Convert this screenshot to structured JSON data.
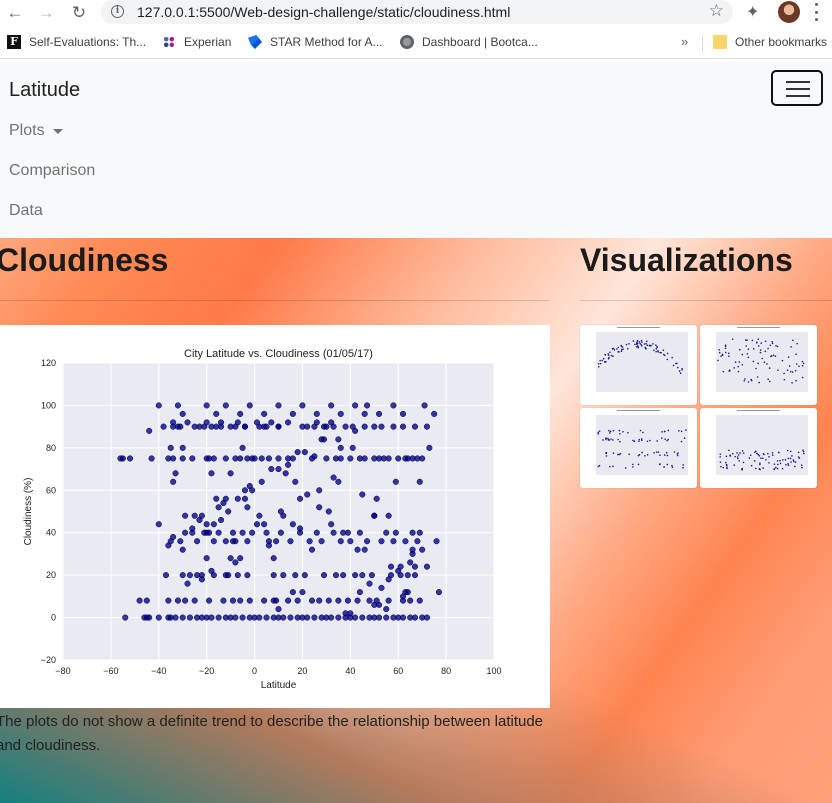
{
  "browser": {
    "url": "127.0.0.1:5500/Web-design-challenge/static/cloudiness.html",
    "bookmarks": [
      {
        "label": "Self-Evaluations: Th...",
        "icon": "faculty-f-icon"
      },
      {
        "label": "Experian",
        "icon": "experian-icon"
      },
      {
        "label": "STAR Method for A...",
        "icon": "star-method-icon"
      },
      {
        "label": "Dashboard | Bootca...",
        "icon": "globe-icon"
      }
    ],
    "more_label": "»",
    "other_bookmarks": "Other bookmarks"
  },
  "navbar": {
    "brand": "Latitude",
    "links": [
      "Plots",
      "Comparison",
      "Data"
    ]
  },
  "main": {
    "title": "Cloudiness",
    "description": "The plots do not show a definite trend to describe the relationship between latitude and cloudiness."
  },
  "sidebar": {
    "title": "Visualizations",
    "thumbnails": [
      "Latitude vs Max Temperature",
      "Latitude vs Humidity",
      "Latitude vs Cloudiness",
      "Latitude vs Wind Speed"
    ]
  },
  "chart_data": {
    "type": "scatter",
    "title": "City Latitude vs. Cloudiness (01/05/17)",
    "xlabel": "Latitude",
    "ylabel": "Cloudiness (%)",
    "xlim": [
      -80,
      100
    ],
    "ylim": [
      -20,
      120
    ],
    "xticks": [
      -80,
      -60,
      -40,
      -20,
      0,
      20,
      40,
      60,
      80,
      100
    ],
    "yticks": [
      -20,
      0,
      20,
      40,
      60,
      80,
      100,
      120
    ],
    "grid": true,
    "marker_color": "#00008b",
    "x": [
      -54,
      -46,
      -45,
      -44,
      -40,
      -36,
      -35,
      -33,
      -30,
      -27,
      -24,
      -22,
      -20,
      -18,
      -15,
      -12,
      -10,
      -8,
      -5,
      -2,
      0,
      2,
      5,
      8,
      10,
      12,
      15,
      18,
      20,
      22,
      25,
      28,
      30,
      32,
      35,
      38,
      40,
      42,
      45,
      48,
      50,
      52,
      55,
      58,
      60,
      62,
      65,
      67,
      70,
      72,
      -55,
      -52,
      -43,
      -36,
      -34,
      -30,
      -26,
      -20,
      -19,
      -17,
      -12,
      -8,
      -6,
      -3,
      0,
      3,
      6,
      10,
      14,
      16,
      24,
      30,
      34,
      36,
      40,
      44,
      46,
      50,
      52,
      54,
      56,
      60,
      64,
      66,
      68,
      70,
      -38,
      -34,
      -32,
      -28,
      -23,
      -20,
      -16,
      -14,
      -10,
      -7,
      -4,
      1,
      4,
      7,
      10,
      14,
      20,
      26,
      29,
      32,
      -34,
      -31,
      -25,
      -21,
      -18,
      -14,
      -8,
      -4,
      2,
      5,
      10,
      22,
      25,
      30,
      33,
      38,
      41,
      46,
      50,
      53,
      58,
      62,
      67,
      72,
      -48,
      -45,
      -36,
      -32,
      -29,
      -25,
      -19,
      -13,
      -9,
      -6,
      -2,
      4,
      9,
      14,
      18,
      24,
      27,
      31,
      35,
      39,
      43,
      48,
      51,
      56,
      62,
      65,
      69,
      -37,
      -30,
      -27,
      -22,
      -17,
      -11,
      -7,
      -3,
      8,
      12,
      17,
      21,
      29,
      34,
      37,
      42,
      45,
      49,
      57,
      61,
      64,
      67,
      -29,
      -26,
      -20,
      -15,
      -9,
      -5,
      -1,
      11,
      19,
      26,
      33,
      39,
      44,
      55,
      59,
      66,
      69,
      -35,
      -31,
      -24,
      -17,
      -12,
      -8,
      -3,
      6,
      15,
      23,
      28,
      36,
      47,
      53,
      58,
      63,
      68,
      -56,
      -44,
      -35,
      -33,
      -30,
      -25,
      -21,
      -16,
      -10,
      -5,
      -1,
      4,
      12,
      19,
      27,
      36,
      43,
      51,
      57,
      63,
      69,
      73,
      -34,
      -29,
      -20,
      -12,
      -6,
      2,
      9,
      16,
      24,
      32,
      41,
      50,
      59,
      67,
      77,
      -40,
      -24,
      -18,
      -9,
      -4,
      8,
      17,
      27,
      37,
      46,
      55,
      64,
      72,
      -30,
      -22,
      -15,
      -7,
      3,
      14,
      28,
      40,
      52,
      62,
      -28,
      -18,
      -10,
      1,
      11,
      22,
      33,
      44,
      56,
      65,
      -36,
      -26,
      -14,
      -4,
      7,
      18,
      29,
      42,
      53,
      60,
      66,
      -34,
      -23,
      -13,
      -2,
      10,
      21,
      35,
      48,
      61,
      70,
      -19,
      -11,
      -1,
      13,
      25,
      38,
      50,
      63,
      -22,
      -8,
      6,
      19,
      31,
      47,
      58,
      71,
      -40,
      -32,
      -20,
      -12,
      -2,
      10,
      20,
      32,
      42,
      52,
      62,
      75,
      -30,
      -16,
      -6,
      4,
      16,
      26,
      36,
      46,
      56,
      66,
      76,
      -20,
      -17,
      -12,
      -3,
      5,
      8,
      10,
      16,
      20,
      35,
      40,
      45,
      50,
      55,
      65,
      78
    ],
    "y": [
      0,
      0,
      0,
      0,
      0,
      0,
      0,
      0,
      0,
      0,
      0,
      0,
      0,
      0,
      0,
      0,
      0,
      0,
      0,
      0,
      0,
      0,
      0,
      0,
      0,
      0,
      0,
      0,
      0,
      0,
      0,
      0,
      0,
      0,
      0,
      0,
      0,
      0,
      0,
      0,
      0,
      0,
      0,
      0,
      0,
      0,
      0,
      0,
      0,
      0,
      75,
      75,
      75,
      75,
      75,
      75,
      75,
      75,
      75,
      75,
      75,
      75,
      75,
      75,
      75,
      75,
      75,
      75,
      75,
      75,
      75,
      75,
      75,
      75,
      75,
      75,
      75,
      75,
      75,
      75,
      75,
      75,
      75,
      75,
      75,
      75,
      90,
      92,
      90,
      92,
      90,
      92,
      90,
      92,
      90,
      92,
      90,
      92,
      90,
      92,
      90,
      92,
      90,
      92,
      90,
      92,
      90,
      90,
      90,
      90,
      90,
      90,
      90,
      90,
      90,
      90,
      90,
      90,
      90,
      90,
      90,
      90,
      90,
      90,
      90,
      90,
      90,
      90,
      90,
      90,
      8,
      8,
      8,
      8,
      8,
      8,
      8,
      8,
      8,
      8,
      8,
      8,
      8,
      8,
      8,
      8,
      8,
      8,
      8,
      8,
      8,
      8,
      8,
      8,
      8,
      8,
      8,
      20,
      20,
      20,
      20,
      20,
      20,
      20,
      20,
      20,
      20,
      20,
      20,
      20,
      20,
      20,
      20,
      20,
      20,
      20,
      20,
      20,
      20,
      40,
      40,
      40,
      40,
      40,
      40,
      40,
      40,
      40,
      40,
      40,
      40,
      40,
      40,
      40,
      40,
      40,
      36,
      36,
      36,
      36,
      36,
      36,
      36,
      36,
      36,
      36,
      36,
      36,
      36,
      36,
      36,
      36,
      36,
      75,
      88,
      80,
      68,
      80,
      48,
      40,
      56,
      68,
      80,
      75,
      44,
      48,
      56,
      60,
      80,
      32,
      56,
      24,
      75,
      64,
      80,
      64,
      48,
      44,
      56,
      28,
      48,
      36,
      12,
      32,
      44,
      80,
      48,
      64,
      24,
      12,
      44,
      20,
      68,
      36,
      56,
      28,
      64,
      52,
      40,
      32,
      4,
      12,
      24,
      32,
      48,
      52,
      56,
      64,
      72,
      84,
      2,
      6,
      10,
      16,
      22,
      28,
      44,
      50,
      58,
      66,
      12,
      18,
      26,
      34,
      42,
      46,
      60,
      70,
      78,
      84,
      88,
      14,
      22,
      30,
      38,
      46,
      54,
      62,
      70,
      78,
      84,
      16,
      24,
      32,
      40,
      50,
      60,
      68,
      76,
      2,
      6,
      12,
      18,
      26,
      34,
      42,
      50,
      100,
      100,
      100,
      100,
      100,
      100,
      100,
      100,
      100,
      100,
      100,
      100,
      96,
      96,
      96,
      96,
      96,
      96,
      96,
      96,
      96,
      96,
      96,
      48,
      32,
      36,
      28,
      44,
      20,
      52,
      40,
      8,
      4,
      44,
      12,
      64,
      36,
      58,
      48
    ]
  }
}
